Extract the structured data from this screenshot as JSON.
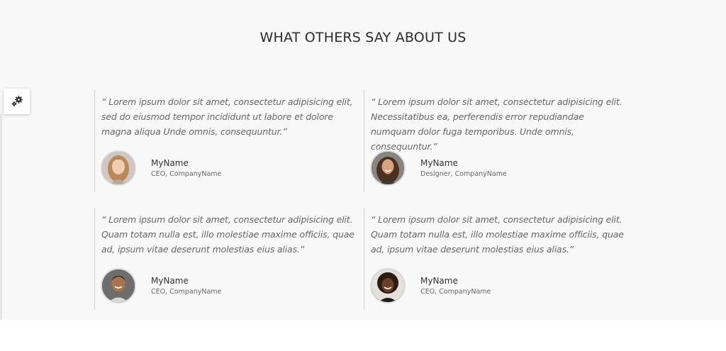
{
  "section": {
    "title": "WHAT OTHERS SAY ABOUT US"
  },
  "settings": {
    "icon": "gears-icon"
  },
  "testimonials": [
    {
      "quote": "“ Lorem ipsum dolor sit amet, consectetur adipisicing elit, sed do eiusmod tempor incididunt ut labore et dolore magna aliqua Unde omnis, consequuntur.”",
      "name": "MyName",
      "role": "CEO, CompanyName",
      "avatar": "woman-long-blonde-hair-avatar"
    },
    {
      "quote": "“ Lorem ipsum dolor sit amet, consectetur adipisicing elit. Necessitatibus ea, perferendis error repudiandae numquam dolor fuga temporibus. Unde omnis, consequuntur.”",
      "name": "MyName",
      "role": "Designer, CompanyName",
      "avatar": "man-long-hair-beard-avatar"
    },
    {
      "quote": "“ Lorem ipsum dolor sit amet, consectetur adipisicing elit. Quam totam nulla est, illo molestiae maxime officiis, quae ad, ipsum vitae deserunt molestias eius alias.”",
      "name": "MyName",
      "role": "CEO, CompanyName",
      "avatar": "man-short-hair-avatar"
    },
    {
      "quote": "“ Lorem ipsum dolor sit amet, consectetur adipisicing elit. Quam totam nulla est, illo molestiae maxime officiis, quae ad, ipsum vitae deserunt molestias eius alias.”",
      "name": "MyName",
      "role": "CEO, CompanyName",
      "avatar": "woman-curly-hair-avatar"
    }
  ]
}
